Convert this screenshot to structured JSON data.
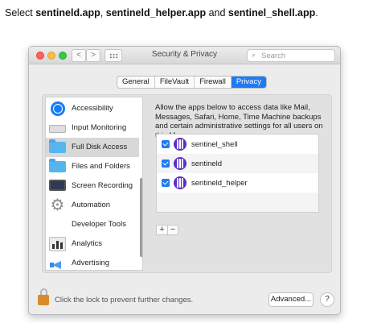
{
  "instruction": {
    "prefix": "Select ",
    "app1": "sentineld.app",
    "sep1": ", ",
    "app2": "sentineld_helper.app",
    "sep2": " and ",
    "app3": "sentinel_shell.app",
    "suffix": "."
  },
  "window": {
    "title": "Security & Privacy",
    "nav_back": "<",
    "nav_forward": ">",
    "search_placeholder": "Search"
  },
  "tabs": [
    {
      "label": "General",
      "active": false
    },
    {
      "label": "FileVault",
      "active": false
    },
    {
      "label": "Firewall",
      "active": false
    },
    {
      "label": "Privacy",
      "active": true
    }
  ],
  "sidebar": {
    "items": [
      {
        "label": "Accessibility",
        "icon": "accessibility-icon"
      },
      {
        "label": "Input Monitoring",
        "icon": "keyboard-icon"
      },
      {
        "label": "Full Disk Access",
        "icon": "folder-icon",
        "selected": true
      },
      {
        "label": "Files and Folders",
        "icon": "folder-icon"
      },
      {
        "label": "Screen Recording",
        "icon": "display-icon"
      },
      {
        "label": "Automation",
        "icon": "gear-icon"
      },
      {
        "label": "Developer Tools",
        "icon": ""
      },
      {
        "label": "Analytics",
        "icon": "chart-icon"
      },
      {
        "label": "Advertising",
        "icon": "megaphone-icon"
      }
    ]
  },
  "main": {
    "description": "Allow the apps below to access data like Mail, Messages, Safari, Home, Time Machine backups and certain administrative settings for all users on this Mac.",
    "apps": [
      {
        "name": "sentinel_shell",
        "checked": true
      },
      {
        "name": "sentineld",
        "checked": true
      },
      {
        "name": "sentineld_helper",
        "checked": true
      }
    ],
    "add_label": "+",
    "remove_label": "−"
  },
  "footer": {
    "lock_text": "Click the lock to prevent further changes.",
    "advanced_label": "Advanced...",
    "help_label": "?"
  },
  "colors": {
    "accent": "#1f7bf2",
    "app_icon": "#5a2ec8"
  }
}
